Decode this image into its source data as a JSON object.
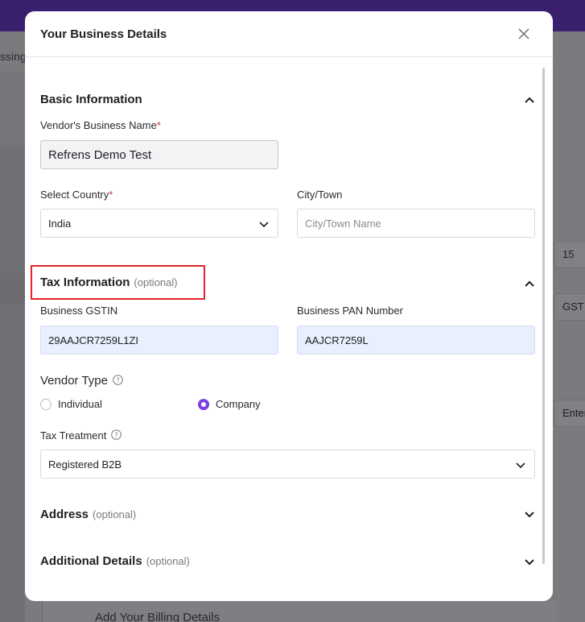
{
  "background": {
    "left_fragment": "ssing",
    "right_number": "15",
    "right_gst": "GST",
    "right_enter": "Enter",
    "bottom_text": "Add Your Billing Details"
  },
  "modal": {
    "title": "Your Business Details",
    "close_icon": "close-icon",
    "basic": {
      "title": "Basic Information",
      "business_name_label": "Vendor's Business Name",
      "business_name_value": "Refrens Demo Test",
      "country_label": "Select Country",
      "country_value": "India",
      "city_label": "City/Town",
      "city_placeholder": "City/Town Name"
    },
    "tax": {
      "title": "Tax Information",
      "optional": "(optional)",
      "gstin_label": "Business GSTIN",
      "gstin_value": "29AAJCR7259L1ZI",
      "pan_label": "Business PAN Number",
      "pan_value": "AAJCR7259L",
      "vendor_type_label": "Vendor Type",
      "vendor_type_options": [
        "Individual",
        "Company"
      ],
      "vendor_type_selected": "Company",
      "tax_treatment_label": "Tax Treatment",
      "tax_treatment_value": "Registered B2B"
    },
    "address": {
      "title": "Address",
      "optional": "(optional)"
    },
    "additional": {
      "title": "Additional Details",
      "optional": "(optional)"
    }
  },
  "colors": {
    "accent": "#7b3fe4",
    "required": "#d6303c",
    "highlight": "#e0242a",
    "topbar": "#3a1f6e"
  }
}
